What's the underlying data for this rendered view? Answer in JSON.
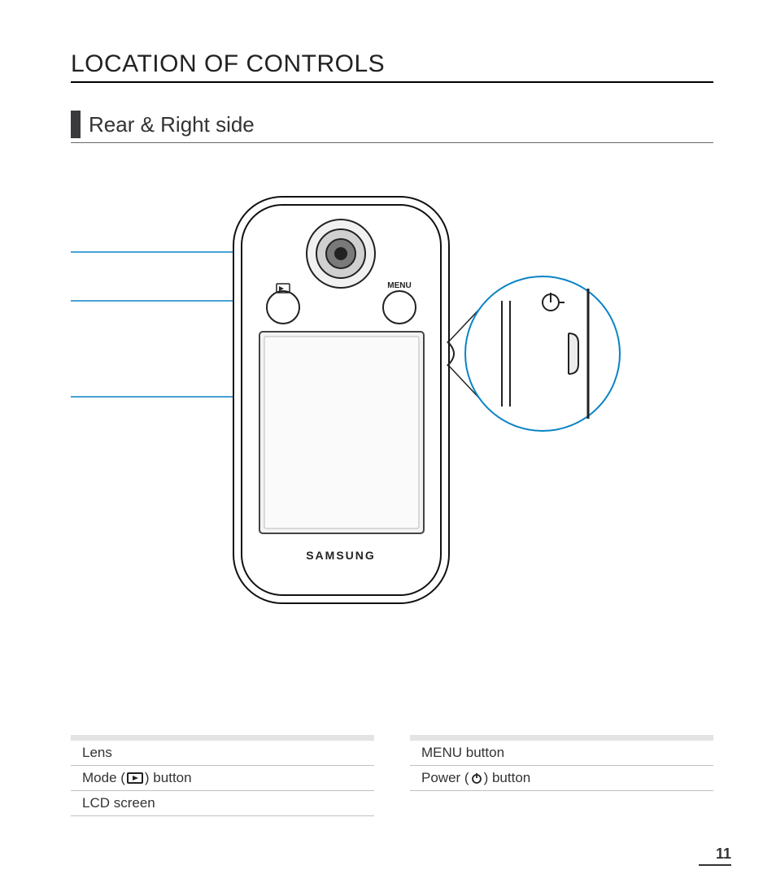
{
  "title": "LOCATION OF CONTROLS",
  "subtitle": "Rear & Right side",
  "device": {
    "brand": "SAMSUNG",
    "menu_label": "MENU"
  },
  "legend": {
    "left": [
      {
        "label": "Lens"
      },
      {
        "label_pre": "Mode (",
        "icon": "playback",
        "label_post": ") button"
      },
      {
        "label": "LCD screen"
      }
    ],
    "right": [
      {
        "label": "MENU button"
      },
      {
        "label_pre": "Power (",
        "icon": "power",
        "label_post": ") button"
      }
    ]
  },
  "page_number": "11"
}
